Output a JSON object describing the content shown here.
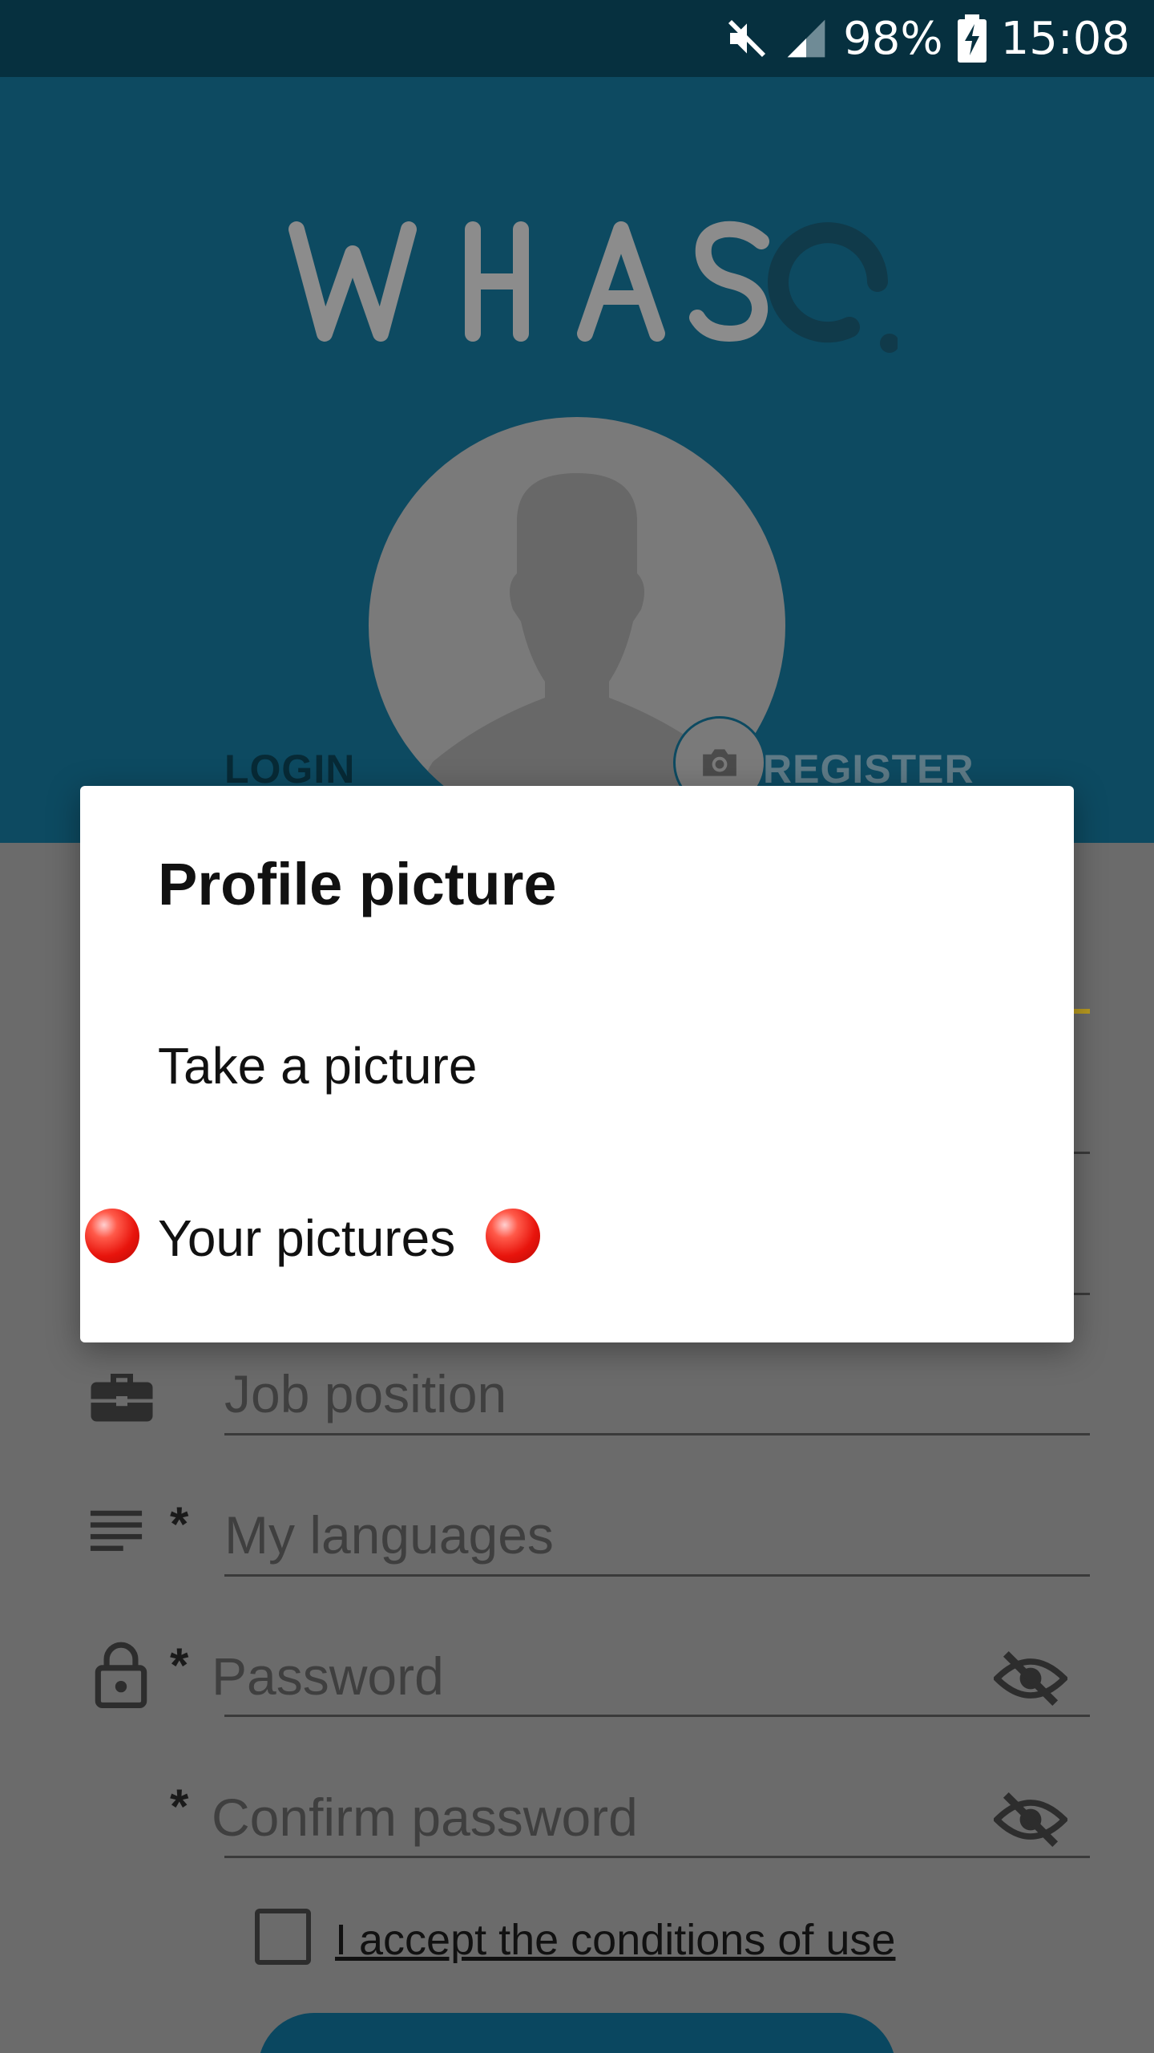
{
  "status_bar": {
    "battery": "98%",
    "time": "15:08",
    "icons": [
      "mute-icon",
      "signal-icon",
      "battery-charging-icon"
    ]
  },
  "header": {
    "logo_text": "WHASQ",
    "tabs": [
      {
        "label": "LOGIN"
      },
      {
        "label": "REGISTER"
      }
    ]
  },
  "form": {
    "fields": [
      {
        "placeholder": "Job position",
        "icon": "briefcase-icon",
        "required": false
      },
      {
        "placeholder": "My languages",
        "icon": "list-icon",
        "required": true
      },
      {
        "placeholder": "Password",
        "icon": "lock-icon",
        "required": true
      },
      {
        "placeholder": "Confirm password",
        "icon": "",
        "required": true
      }
    ],
    "required_mark": "*",
    "accept_label": "I accept the conditions of use"
  },
  "dialog": {
    "title": "Profile picture",
    "options": [
      {
        "label": "Take a picture"
      },
      {
        "label": "Your pictures"
      }
    ]
  },
  "colors": {
    "header_bg": "#0d4a61",
    "status_bg": "#06303f",
    "scrim": "#6b6b6b",
    "dialog_bg": "#ffffff",
    "marker": "#e8140c"
  }
}
